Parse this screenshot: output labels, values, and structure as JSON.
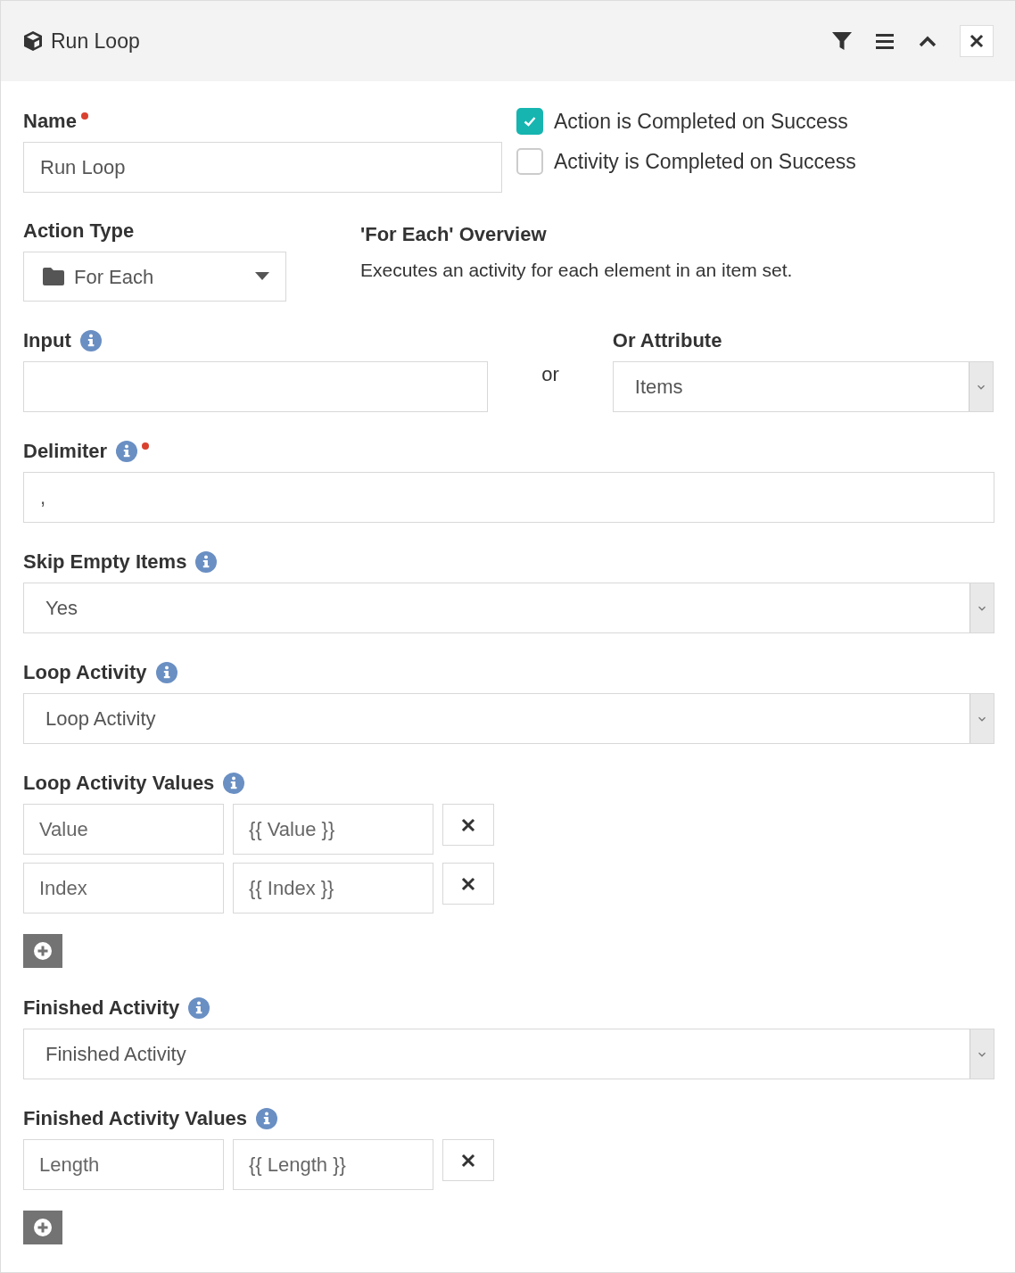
{
  "panel": {
    "title": "Run Loop"
  },
  "name": {
    "label": "Name",
    "required": true,
    "value": "Run Loop"
  },
  "options": [
    {
      "label": "Action is Completed on Success",
      "checked": true
    },
    {
      "label": "Activity is Completed on Success",
      "checked": false
    }
  ],
  "action_type": {
    "label": "Action Type",
    "value": "For Each"
  },
  "overview": {
    "title": "'For Each' Overview",
    "text": "Executes an activity for each element in an item set."
  },
  "input": {
    "label": "Input",
    "info": true
  },
  "or_text": "or",
  "attribute": {
    "label": "Or Attribute",
    "value": "Items"
  },
  "sections": [
    {
      "kind": "text",
      "label": "Delimiter",
      "info": true,
      "required": true,
      "value": ","
    },
    {
      "kind": "select",
      "label": "Skip Empty Items",
      "info": true,
      "required": false,
      "value": "Yes"
    },
    {
      "kind": "select",
      "label": "Loop Activity",
      "info": true,
      "required": false,
      "value": "Loop Activity"
    },
    {
      "kind": "pairs",
      "label": "Loop Activity Values",
      "info": true,
      "required": false,
      "pairs": [
        {
          "key": "Value",
          "value": "{{ Value }}"
        },
        {
          "key": "Index",
          "value": "{{ Index }}"
        }
      ]
    },
    {
      "kind": "select",
      "label": "Finished Activity",
      "info": true,
      "required": false,
      "value": "Finished Activity"
    },
    {
      "kind": "pairs",
      "label": "Finished Activity Values",
      "info": true,
      "required": false,
      "pairs": [
        {
          "key": "Length",
          "value": "{{ Length }}"
        }
      ]
    }
  ]
}
